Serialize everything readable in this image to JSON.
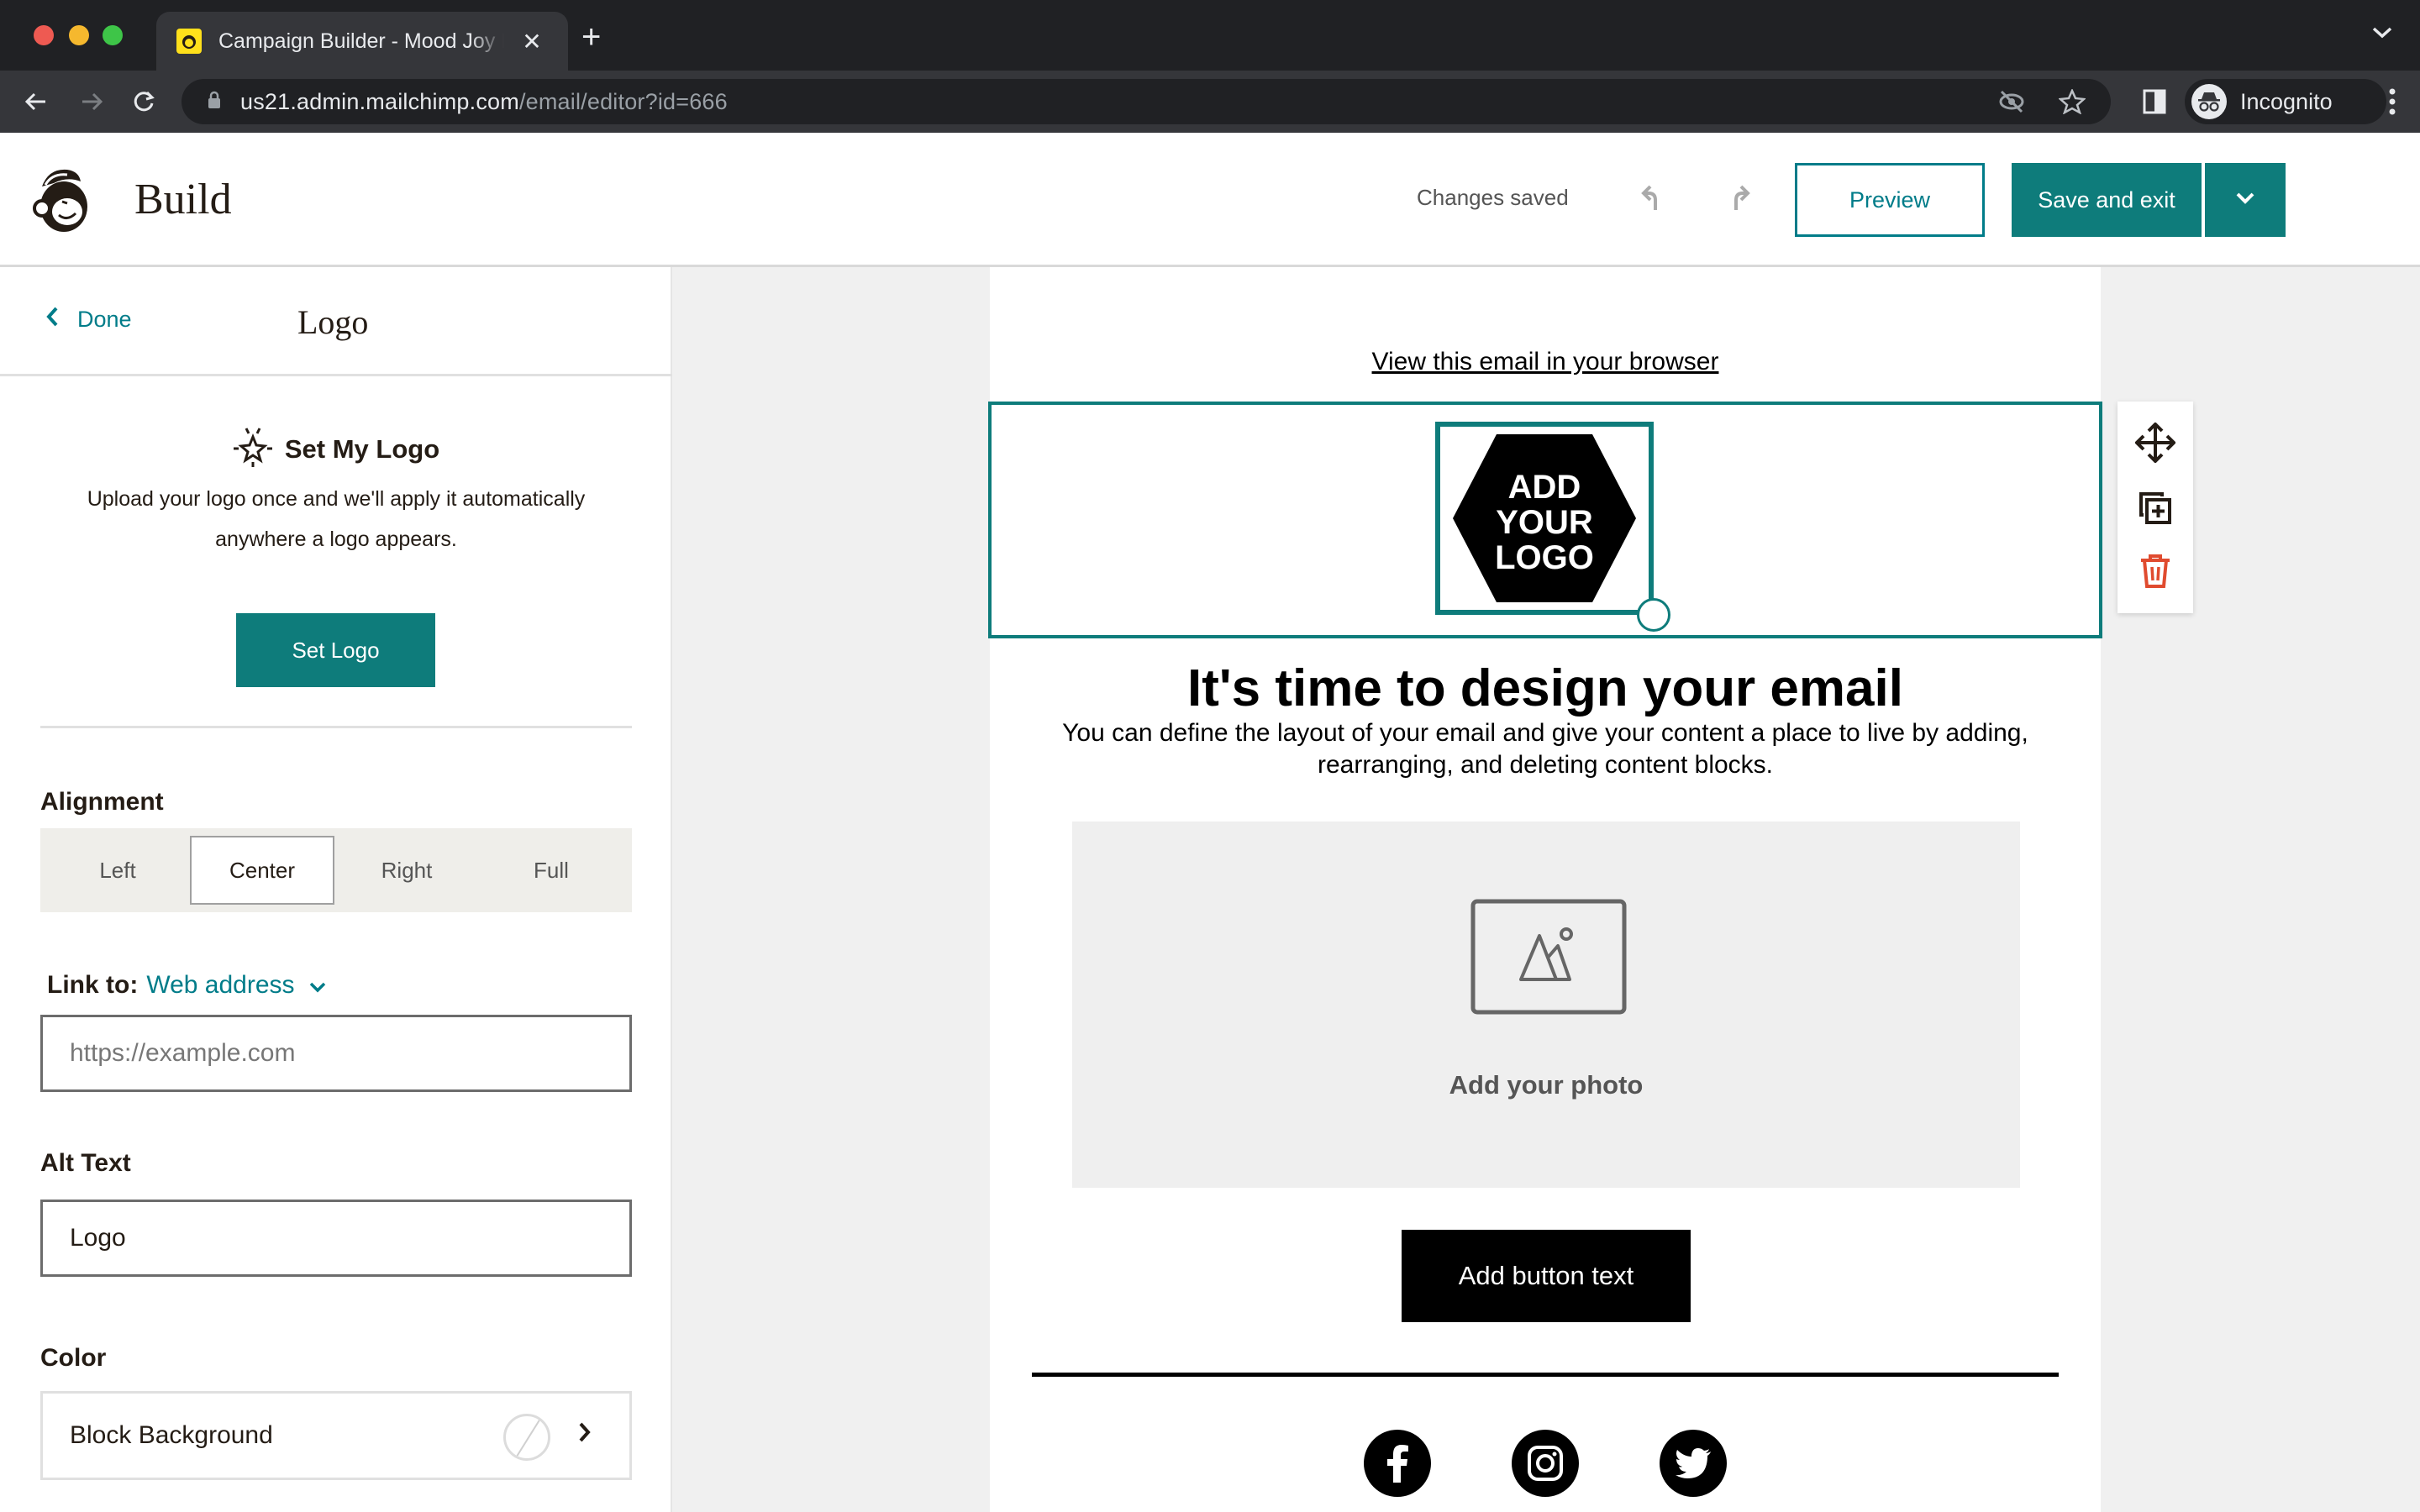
{
  "browser": {
    "tab_title": "Campaign Builder - Mood Joy Inc",
    "tab_favicon": "mailchimp-favicon",
    "url_host": "us21.admin.mailchimp.com",
    "url_path": "/email/editor?id=666",
    "profile_label": "Incognito",
    "icons": [
      "back-icon",
      "forward-icon",
      "reload-icon",
      "lock-icon",
      "eye-off-icon",
      "star-icon",
      "sidepanel-icon",
      "incognito-icon",
      "kebab-icon",
      "tab-list-icon",
      "new-tab-icon",
      "close-icon"
    ]
  },
  "header": {
    "title": "Build",
    "status": "Changes saved",
    "preview_label": "Preview",
    "save_label": "Save and exit",
    "accent_color": "#007c89"
  },
  "panel": {
    "done_label": "Done",
    "title": "Logo",
    "set_logo": {
      "heading": "Set My Logo",
      "description": "Upload your logo once and we'll apply it automatically anywhere a logo appears.",
      "button_label": "Set Logo"
    },
    "alignment": {
      "label": "Alignment",
      "options": [
        "Left",
        "Center",
        "Right",
        "Full"
      ],
      "selected": "Center"
    },
    "link": {
      "label": "Link to:",
      "type": "Web address",
      "placeholder": "https://example.com",
      "value": ""
    },
    "alt_text": {
      "label": "Alt Text",
      "value": "Logo"
    },
    "color": {
      "label": "Color",
      "row_label": "Block Background",
      "value": "none"
    }
  },
  "email": {
    "view_in_browser": "View this email in your browser",
    "logo_placeholder": [
      "ADD",
      "YOUR",
      "LOGO"
    ],
    "heading": "It's time to design your email",
    "body": "You can define the layout of your email and give your content a place to live by adding, rearranging, and deleting content blocks.",
    "photo_label": "Add your photo",
    "button_label": "Add button text",
    "social": [
      "facebook",
      "instagram",
      "twitter"
    ]
  },
  "block_tools": [
    "move",
    "duplicate",
    "delete"
  ]
}
